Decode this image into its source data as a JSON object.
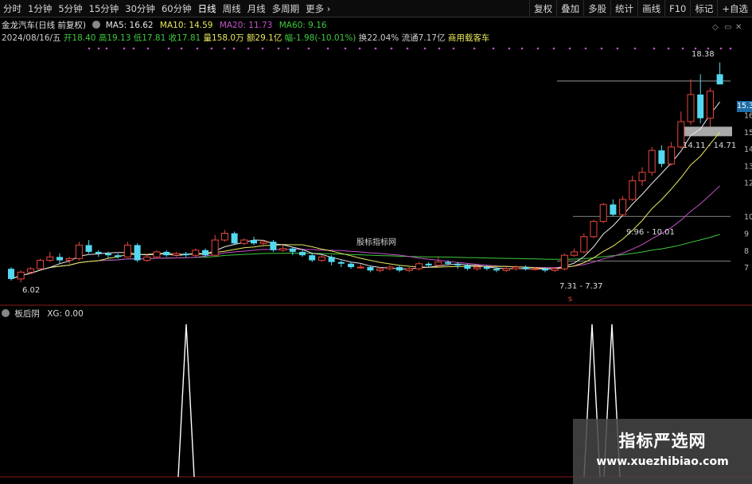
{
  "toolbar": {
    "periods": [
      "分时",
      "1分钟",
      "5分钟",
      "15分钟",
      "30分钟",
      "60分钟",
      "日线",
      "周线",
      "月线",
      "多周期",
      "更多"
    ],
    "active_period": "日线",
    "right_buttons": [
      "复权",
      "叠加",
      "多股",
      "统计",
      "画线",
      "F10",
      "标记",
      "+自选"
    ]
  },
  "header": {
    "stock_title": "金龙汽车(日线 前复权)",
    "ma5": "MA5: 16.62",
    "ma10": "MA10: 14.59",
    "ma20": "MA20: 11.73",
    "ma60": "MA60: 9.16",
    "date": "2024/08/16/五",
    "open": "开18.40",
    "high": "高19.13",
    "low": "低17.81",
    "close": "收17.81",
    "volume": "量158.0万",
    "amount": "额29.1亿",
    "change": "幅-1.98(-10.01%)",
    "turnover": "换22.04%",
    "float_cap": "流通7.17亿",
    "sector": "商用载客车"
  },
  "annotations": {
    "high_label": "18.38",
    "range_high": "14.11 - 14.71",
    "range_mid": "9.96 - 10.01",
    "range_low": "7.31 - 7.37",
    "low_label": "6.02",
    "current_price": "15.3",
    "center_mark": "股标指标网",
    "signal_mark": "s"
  },
  "price_axis": [
    "16",
    "15",
    "14",
    "13",
    "12",
    "10",
    "9",
    "8",
    "7"
  ],
  "sub_panel": {
    "title": "板后阴",
    "value": "XG: 0.00"
  },
  "watermark": {
    "line1": "指标严选网",
    "line2": "www.xuezhibiao.com"
  },
  "colors": {
    "up": "#e8463c",
    "down": "#53d8f0",
    "ma5": "#e8e8e8",
    "ma10": "#e8e860",
    "ma20": "#c552c8",
    "ma60": "#3ec83e",
    "signal": "#ffffff"
  },
  "chart_data": {
    "type": "candlestick",
    "price_range": [
      5.5,
      19.5
    ],
    "candles": [
      [
        6.9,
        6.3,
        7.0,
        6.2
      ],
      [
        6.3,
        6.7,
        6.8,
        6.1
      ],
      [
        6.7,
        6.9,
        7.0,
        6.6
      ],
      [
        6.9,
        7.4,
        7.5,
        6.9
      ],
      [
        7.4,
        7.6,
        7.9,
        7.3
      ],
      [
        7.6,
        7.4,
        7.8,
        7.2
      ],
      [
        7.4,
        7.5,
        7.6,
        7.2
      ],
      [
        7.5,
        8.3,
        8.5,
        7.4
      ],
      [
        8.3,
        7.9,
        8.6,
        7.8
      ],
      [
        7.9,
        7.8,
        8.0,
        7.6
      ],
      [
        7.8,
        7.7,
        7.9,
        7.5
      ],
      [
        7.7,
        7.6,
        7.8,
        7.5
      ],
      [
        7.6,
        8.3,
        8.5,
        7.6
      ],
      [
        8.3,
        7.4,
        8.4,
        7.3
      ],
      [
        7.4,
        7.6,
        7.8,
        7.3
      ],
      [
        7.6,
        7.9,
        8.0,
        7.5
      ],
      [
        7.9,
        7.7,
        8.0,
        7.6
      ],
      [
        7.7,
        7.8,
        7.9,
        7.6
      ],
      [
        7.8,
        7.7,
        7.9,
        7.6
      ],
      [
        7.7,
        8.0,
        8.1,
        7.6
      ],
      [
        8.0,
        7.7,
        8.1,
        7.6
      ],
      [
        7.7,
        8.6,
        8.9,
        7.6
      ],
      [
        8.6,
        9.0,
        9.2,
        8.5
      ],
      [
        9.0,
        8.4,
        9.1,
        8.3
      ],
      [
        8.4,
        8.6,
        8.7,
        8.3
      ],
      [
        8.6,
        8.4,
        8.8,
        8.3
      ],
      [
        8.4,
        8.5,
        8.6,
        8.2
      ],
      [
        8.5,
        8.0,
        8.6,
        7.9
      ],
      [
        8.0,
        8.1,
        8.3,
        7.9
      ],
      [
        8.1,
        7.9,
        8.2,
        7.7
      ],
      [
        7.9,
        7.7,
        8.0,
        7.6
      ],
      [
        7.7,
        7.4,
        7.8,
        7.3
      ],
      [
        7.4,
        7.6,
        7.7,
        7.3
      ],
      [
        7.6,
        7.3,
        7.7,
        7.1
      ],
      [
        7.3,
        7.2,
        7.4,
        7.0
      ],
      [
        7.2,
        7.0,
        7.3,
        6.9
      ],
      [
        7.0,
        7.0,
        7.2,
        6.9
      ],
      [
        7.0,
        6.8,
        7.1,
        6.7
      ],
      [
        6.8,
        6.9,
        7.0,
        6.7
      ],
      [
        6.9,
        7.0,
        7.1,
        6.8
      ],
      [
        7.0,
        6.8,
        7.1,
        6.7
      ],
      [
        6.8,
        6.9,
        7.0,
        6.7
      ],
      [
        6.9,
        7.2,
        7.3,
        6.8
      ],
      [
        7.2,
        7.1,
        7.3,
        7.0
      ],
      [
        7.1,
        7.3,
        7.6,
        7.0
      ],
      [
        7.3,
        7.2,
        7.4,
        7.1
      ],
      [
        7.2,
        7.1,
        7.3,
        6.9
      ],
      [
        7.1,
        6.9,
        7.2,
        6.8
      ],
      [
        6.9,
        7.0,
        7.1,
        6.8
      ],
      [
        7.0,
        6.9,
        7.1,
        6.8
      ],
      [
        6.9,
        6.8,
        7.0,
        6.7
      ],
      [
        6.8,
        6.9,
        7.0,
        6.7
      ],
      [
        6.9,
        7.0,
        7.1,
        6.8
      ],
      [
        7.0,
        6.9,
        7.1,
        6.8
      ],
      [
        6.9,
        6.9,
        7.0,
        6.8
      ],
      [
        6.9,
        6.8,
        7.0,
        6.7
      ],
      [
        6.8,
        6.9,
        7.0,
        6.7
      ],
      [
        6.9,
        7.7,
        7.8,
        6.8
      ],
      [
        7.7,
        7.9,
        8.1,
        7.6
      ],
      [
        7.9,
        8.8,
        9.0,
        7.8
      ],
      [
        8.8,
        9.7,
        9.8,
        8.7
      ],
      [
        9.7,
        10.7,
        10.8,
        9.6
      ],
      [
        10.7,
        10.1,
        11.0,
        10.0
      ],
      [
        10.1,
        11.0,
        11.2,
        10.0
      ],
      [
        11.0,
        12.1,
        12.4,
        10.9
      ],
      [
        12.1,
        12.6,
        12.9,
        11.8
      ],
      [
        12.6,
        13.9,
        14.1,
        12.4
      ],
      [
        13.9,
        13.1,
        14.2,
        12.9
      ],
      [
        13.1,
        14.1,
        14.4,
        13.0
      ],
      [
        14.1,
        15.6,
        16.2,
        14.0
      ],
      [
        15.6,
        17.2,
        18.1,
        15.4
      ],
      [
        17.2,
        15.8,
        18.4,
        15.5
      ],
      [
        15.8,
        17.4,
        17.6,
        15.3
      ],
      [
        18.4,
        17.8,
        19.1,
        17.8
      ]
    ],
    "signal_bars": [
      14,
      62,
      64
    ]
  }
}
